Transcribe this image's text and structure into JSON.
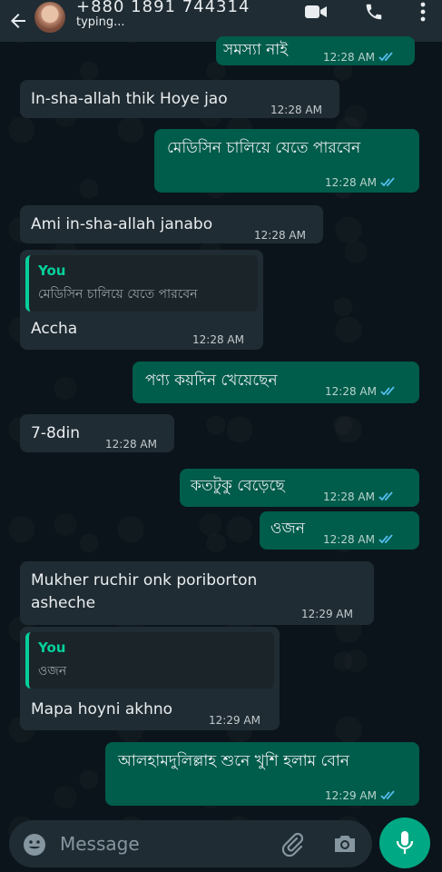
{
  "header": {
    "contact_name": "+880 1891 744314",
    "status": "typing...",
    "back_icon": "arrow-left-icon",
    "video_icon": "video-call-icon",
    "call_icon": "phone-icon",
    "menu_icon": "more-vert-icon"
  },
  "messages": [
    {
      "dir": "out",
      "text": "সমস্যা নাই",
      "time": "12:28 AM",
      "read": true
    },
    {
      "dir": "in",
      "text": "In-sha-allah thik Hoye jao",
      "time": "12:28 AM"
    },
    {
      "dir": "out",
      "text": "মেডিসিন চালিয়ে যেতে পারবেন",
      "time": "12:28 AM",
      "read": true
    },
    {
      "dir": "in",
      "text": "Ami in-sha-allah janabo",
      "time": "12:28 AM"
    },
    {
      "dir": "in",
      "quote_author": "You",
      "quote_text": "মেডিসিন চালিয়ে যেতে পারবেন",
      "text": "Accha",
      "time": "12:28 AM"
    },
    {
      "dir": "out",
      "text": "পণ্য কয়দিন খেয়েছেন",
      "time": "12:28 AM",
      "read": true
    },
    {
      "dir": "in",
      "text": "7-8din",
      "time": "12:28 AM"
    },
    {
      "dir": "out",
      "text": "কতটুকু বেড়েছে",
      "time": "12:28 AM",
      "read": true
    },
    {
      "dir": "out",
      "text": "ওজন",
      "time": "12:28 AM",
      "read": true
    },
    {
      "dir": "in",
      "text": "Mukher ruchir onk poriborton asheche",
      "line1": "Mukher ruchir onk poriborton",
      "line2": "asheche",
      "time": "12:29 AM"
    },
    {
      "dir": "in",
      "quote_author": "You",
      "quote_text": "ওজন",
      "text": "Mapa hoyni akhno",
      "time": "12:29 AM"
    },
    {
      "dir": "out",
      "text": "আলহামদুলিল্লাহ শুনে খুশি হলাম বোন",
      "time": "12:29 AM",
      "read": true
    }
  ],
  "input": {
    "placeholder": "Message",
    "emoji_icon": "emoji-icon",
    "attach_icon": "paperclip-icon",
    "camera_icon": "camera-icon",
    "mic_icon": "microphone-icon"
  },
  "colors": {
    "background": "#0b141a",
    "header": "#1f2c33",
    "incoming": "#202c33",
    "outgoing": "#005c4b",
    "accent": "#00a884",
    "read_ticks": "#53bdeb"
  }
}
